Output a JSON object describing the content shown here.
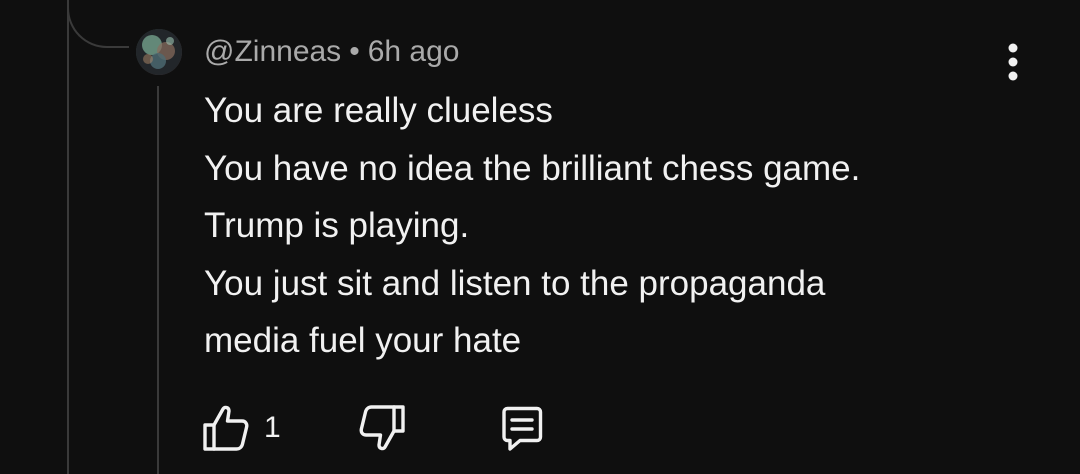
{
  "comment": {
    "author": "@Zinneas",
    "separator": "•",
    "time": "6h ago",
    "lines": [
      "You are really clueless",
      "You have no idea the brilliant chess game.",
      "Trump is playing.",
      "You just sit and listen to the propaganda",
      "media fuel your hate"
    ],
    "like_count": "1"
  },
  "icons": {
    "avatar": "user-avatar",
    "menu": "more-vertical-icon",
    "like": "thumbs-up-icon",
    "dislike": "thumbs-down-icon",
    "reply": "reply-comment-icon"
  },
  "colors": {
    "background": "#0f0f0f",
    "text_primary": "#f1f1f1",
    "text_secondary": "#aaaaaa",
    "thread_line": "#3a3a3a"
  }
}
